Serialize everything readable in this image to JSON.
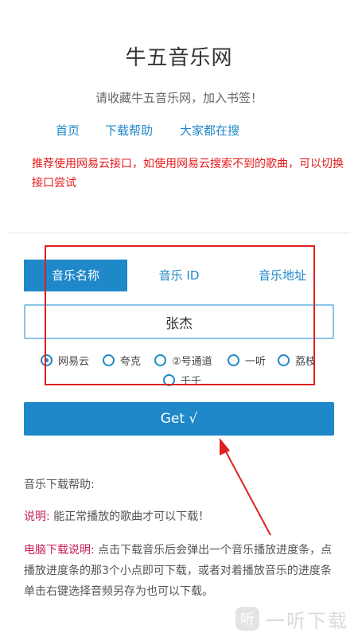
{
  "header": {
    "title": "牛五音乐网",
    "subtitle": "请收藏牛五音乐网，加入书签！"
  },
  "nav": [
    {
      "label": "首页"
    },
    {
      "label": "下载帮助"
    },
    {
      "label": "大家都在搜"
    }
  ],
  "notice": "推荐使用网易云接口，如使用网易云搜索不到的歌曲，可以切换接口尝试",
  "tabs": [
    {
      "label": "音乐名称",
      "active": true
    },
    {
      "label": "音乐 ID",
      "active": false
    },
    {
      "label": "音乐地址",
      "active": false
    }
  ],
  "search": {
    "value": "张杰"
  },
  "sources": [
    {
      "label": "网易云",
      "selected": true
    },
    {
      "label": "夸克",
      "selected": false
    },
    {
      "label": "②号通道",
      "selected": false
    },
    {
      "label": "一听",
      "selected": false
    },
    {
      "label": "荔枝",
      "selected": false
    },
    {
      "label": "千千",
      "selected": false
    }
  ],
  "get_button": {
    "label": "Get √"
  },
  "help": {
    "title": "音乐下载帮助:",
    "note_label": "说明:",
    "note_text": "能正常播放的歌曲才可以下载！",
    "pc_label": "电脑下载说明:",
    "pc_text": "点击下载音乐后会弹出一个音乐播放进度条，点播放进度条的那3个小点即可下载，或者对着播放音乐的进度条单击右键选择音频另存为也可以下载。"
  },
  "watermark": {
    "icon": "听",
    "text": "一听下载"
  },
  "colors": {
    "accent": "#1e88c8",
    "notice": "#e51c1c",
    "label": "#c81e5a",
    "annotation": "#e02020"
  }
}
